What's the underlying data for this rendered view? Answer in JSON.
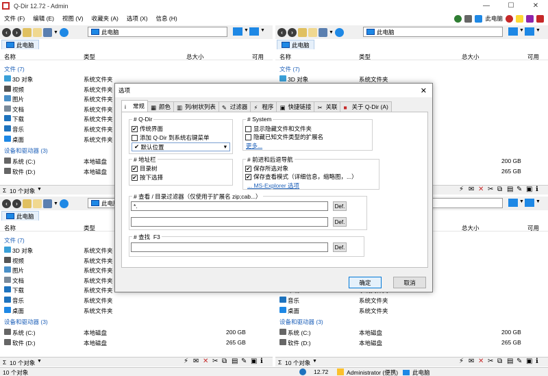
{
  "window": {
    "title": "Q-Dir 12.72 - Admin",
    "controls": [
      "—",
      "☐",
      "✕"
    ]
  },
  "menu": {
    "items": [
      "文件 (F)",
      "编辑 (E)",
      "视图 (V)",
      "收藏夹 (A)",
      "选项 (X)",
      "信息 (H)"
    ],
    "right_label": "此电脑"
  },
  "pane": {
    "address": "此电脑",
    "tab": "此电脑",
    "columns": {
      "name": "名称",
      "type": "类型",
      "total": "总大小",
      "avail": "可用"
    },
    "folder_group": "文件 (7)",
    "folders": [
      {
        "name": "3D 对象",
        "type": "系统文件夹",
        "color": "#3aa0d8"
      },
      {
        "name": "视频",
        "type": "系统文件夹",
        "color": "#555555"
      },
      {
        "name": "图片",
        "type": "系统文件夹",
        "color": "#4a90c8"
      },
      {
        "name": "文档",
        "type": "系统文件夹",
        "color": "#7a8a9a"
      },
      {
        "name": "下载",
        "type": "系统文件夹",
        "color": "#1e73be"
      },
      {
        "name": "音乐",
        "type": "系统文件夹",
        "color": "#1e73be"
      },
      {
        "name": "桌面",
        "type": "系统文件夹",
        "color": "#1e88e5"
      }
    ],
    "drive_group": "设备和驱动器 (3)",
    "drives": [
      {
        "name": "系统 (C:)",
        "type": "本地磁盘",
        "total": "200 GB"
      },
      {
        "name": "软件 (D:)",
        "type": "本地磁盘",
        "total": "265 GB"
      }
    ],
    "status_count": "10 个对象"
  },
  "bottom": {
    "count": "10 个对象",
    "version": "12.72",
    "user": "Administrator (便携)",
    "location": "此电脑"
  },
  "dialog": {
    "title": "选项",
    "close": "✕",
    "tabs": [
      {
        "label": "常规",
        "icon": "i",
        "active": true
      },
      {
        "label": "颜色",
        "icon": "▦"
      },
      {
        "label": "列/树状列表",
        "icon": "▥"
      },
      {
        "label": "过滤器",
        "icon": "✎"
      },
      {
        "label": "程序",
        "icon": "⚡"
      },
      {
        "label": "快捷链接",
        "icon": "▣"
      },
      {
        "label": "关联",
        "icon": "✂"
      },
      {
        "label": "关于 Q-Dir (A)",
        "icon": "■"
      }
    ],
    "qdir_group": "# Q-Dir",
    "qdir_opts": [
      {
        "label": "传统界面",
        "checked": true
      },
      {
        "label": "添加 Q-Dir 到系统右键菜单",
        "checked": false
      }
    ],
    "default_pos": "默认位置",
    "system_group": "# System",
    "system_opts": [
      {
        "label": "显示隐藏文件和文件夹",
        "checked": false
      },
      {
        "label": "隐藏已知文件类型的扩展名",
        "checked": false
      }
    ],
    "more_link": "更多...",
    "addr_group": "# 地址栏",
    "addr_opts": [
      {
        "label": "目录树",
        "checked": true
      },
      {
        "label": "按下选择",
        "checked": true
      }
    ],
    "nav_group": "# 前进和后退导航",
    "nav_opts": [
      {
        "label": "保存所选对象",
        "checked": true
      },
      {
        "label": "保存查看模式（详细信息，缩略图，...）",
        "checked": true
      }
    ],
    "ms_link": "... MS-Explorer 选项",
    "filter_group": "# 查看 / 目录过滤器（仅使用于扩展名 zip;cab...）",
    "filter_value1": "*.",
    "filter_value2": "",
    "def_label": "Def.",
    "find_group": "# 查找",
    "find_key": "F3",
    "find_value": "",
    "ok": "确定",
    "cancel": "取消"
  }
}
